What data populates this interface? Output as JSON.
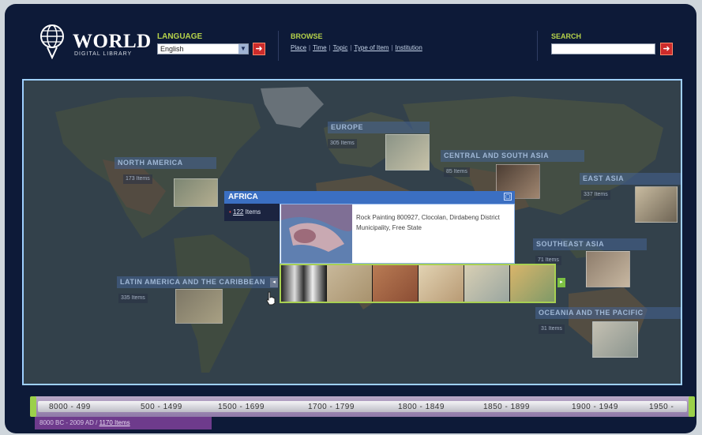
{
  "header": {
    "logo_title": "WORLD",
    "logo_subtitle": "DIGITAL LIBRARY",
    "language_label": "LANGUAGE",
    "language_value": "English",
    "browse_label": "BROWSE",
    "browse_links": [
      "Place",
      "Time",
      "Topic",
      "Type of Item",
      "Institution"
    ],
    "search_label": "SEARCH",
    "search_value": ""
  },
  "regions": {
    "europe": {
      "name": "EUROPE",
      "count": "305 Items"
    },
    "north_america": {
      "name": "NORTH AMERICA",
      "count": "173 Items"
    },
    "central_south_asia": {
      "name": "CENTRAL AND SOUTH ASIA",
      "count": "85 Items"
    },
    "east_asia": {
      "name": "EAST ASIA",
      "count": "337 Items"
    },
    "southeast_asia": {
      "name": "SOUTHEAST ASIA",
      "count": "71 Items"
    },
    "latin_america": {
      "name": "LATIN AMERICA AND THE CARIBBEAN",
      "count": "335 Items"
    },
    "oceania": {
      "name": "OCEANIA AND THE PACIFIC",
      "count": "31 Items"
    }
  },
  "popup": {
    "title": "AFRICA",
    "count_number": "122",
    "count_unit": "Items",
    "caption": "Rock Painting 800927, Clocolan, Dirdabeng District Municipality, Free State"
  },
  "timeline": {
    "ranges": [
      "8000 - 499",
      "500 - 1499",
      "1500 - 1699",
      "1700 - 1799",
      "1800 - 1849",
      "1850 - 1899",
      "1900 - 1949",
      "1950 -"
    ],
    "range_text": "8000 BC - 2009 AD /",
    "range_items": "1170 Items"
  },
  "colors": {
    "header_bg": "#0d1a38",
    "label_green": "#b6d34a",
    "go_red": "#cc2b2b",
    "popup_blue": "#3b6fc2",
    "timeline_purple": "#6e3b8c"
  }
}
